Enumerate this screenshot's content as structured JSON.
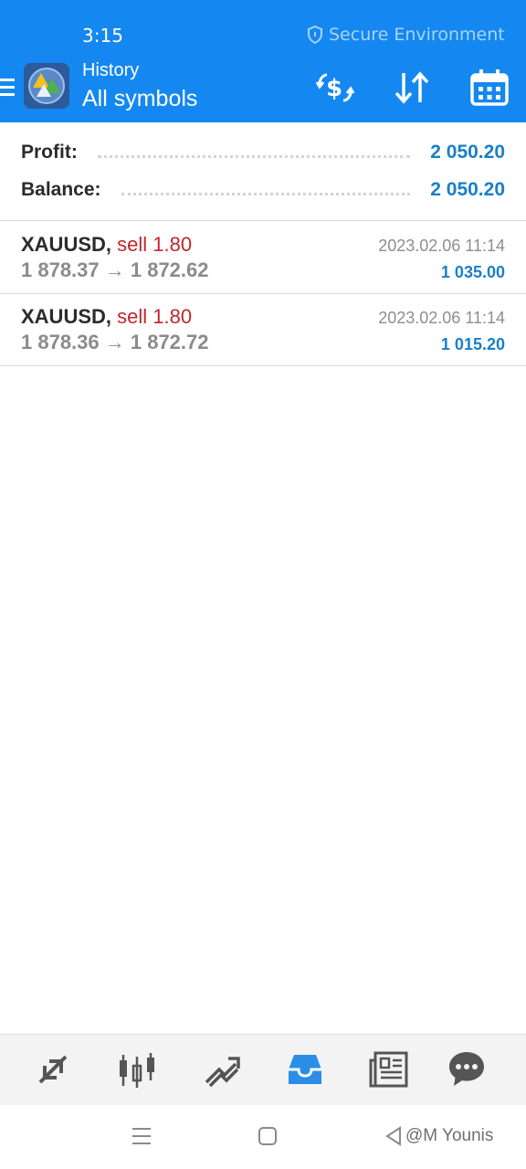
{
  "status_bar": {
    "time": "3:15",
    "secure_label": "Secure Environment"
  },
  "header": {
    "subtitle": "History",
    "title": "All symbols",
    "icons": [
      "menu-icon",
      "app-logo",
      "currency-exchange-icon",
      "sort-icon",
      "calendar-icon"
    ]
  },
  "summary": {
    "profit_label": "Profit:",
    "profit_value": "2 050.20",
    "balance_label": "Balance:",
    "balance_value": "2 050.20"
  },
  "deals": [
    {
      "symbol": "XAUUSD,",
      "side": "sell 1.80",
      "prices": "1 878.37 → 1 872.62",
      "time": "2023.02.06 11:14",
      "profit": "1 035.00"
    },
    {
      "symbol": "XAUUSD,",
      "side": "sell 1.80",
      "prices": "1 878.36 → 1 872.72",
      "time": "2023.02.06 11:14",
      "profit": "1 015.20"
    }
  ],
  "bottom_nav": {
    "items": [
      "quotes-icon",
      "chart-icon",
      "trade-icon",
      "history-icon",
      "news-icon",
      "chat-icon"
    ],
    "active": "history-icon"
  },
  "watermark": "@M Younis",
  "colors": {
    "header_bg": "#1488f0",
    "accent_blue": "#1a7fc8",
    "sell_red": "#c0262c",
    "price_gray": "#8b8b8b",
    "nav_active": "#2a8ee6",
    "nav_inactive": "#555555"
  }
}
